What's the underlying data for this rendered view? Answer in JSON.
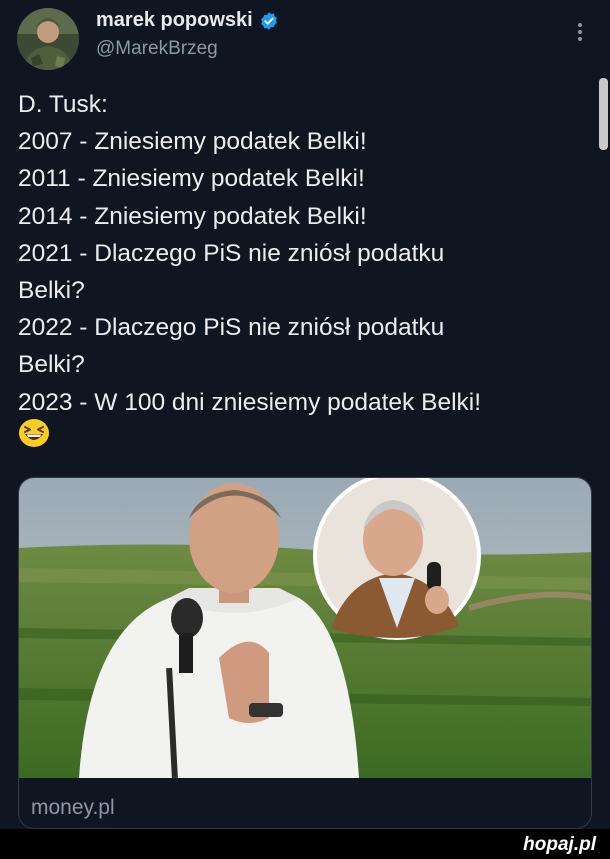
{
  "author": {
    "display_name": "marek popowski",
    "handle": "@MarekBrzeg",
    "verified": true,
    "avatar_icon": "avatar-soldier-photo"
  },
  "tweet": {
    "lines": [
      "D. Tusk:",
      "2007 - Zniesiemy podatek Belki!",
      "2011 - Zniesiemy podatek Belki!",
      "2014 - Zniesiemy podatek Belki!",
      "2021 - Dlaczego PiS nie zniósł podatku",
      "Belki?",
      "2022 - Dlaczego PiS nie zniósł podatku",
      "Belki?",
      "2023 - W 100 dni zniesiemy podatek Belki!"
    ],
    "emoji": "grinning-squinting-face-emoji"
  },
  "link_card": {
    "domain": "money.pl"
  },
  "watermark": {
    "brand": "hopaj.pl"
  },
  "colors": {
    "background": "#0f1621",
    "text": "#e7e9ea",
    "muted": "#8b98a5",
    "verified": "#1d9bf0"
  }
}
